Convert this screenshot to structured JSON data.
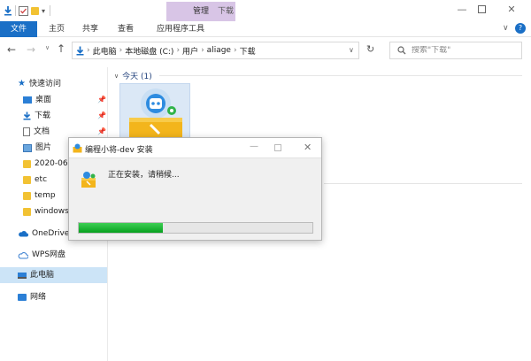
{
  "explorer": {
    "ribbon_tabs": [
      {
        "label": "文件"
      },
      {
        "label": "主页"
      },
      {
        "label": "共享"
      },
      {
        "label": "查看"
      },
      {
        "label": "应用程序工具"
      }
    ],
    "contextual_tab": "管理",
    "window_title": "下载",
    "address_path": [
      "此电脑",
      "本地磁盘 (C:)",
      "用户",
      "aliage",
      "下载"
    ],
    "search_placeholder": "搜索\"下载\"",
    "nav": {
      "quick_access": "快速访问",
      "quick_items": [
        {
          "label": "桌面",
          "pinned": true
        },
        {
          "label": "下载",
          "pinned": true
        },
        {
          "label": "文档",
          "pinned": true
        },
        {
          "label": "图片",
          "pinned": true
        },
        {
          "label": "2020-06",
          "pinned": false
        },
        {
          "label": "etc",
          "pinned": false
        },
        {
          "label": "temp",
          "pinned": false
        },
        {
          "label": "windows",
          "pinned": false
        }
      ],
      "onedrive": "OneDrive",
      "wps": "WPS网盘",
      "this_pc": "此电脑",
      "network": "网络"
    },
    "group_header": "今天 (1)"
  },
  "installer": {
    "title": "编程小将-dev 安装",
    "message": "正在安装，请稍候...",
    "progress_percent": 36
  },
  "colors": {
    "accent": "#1a6fc6",
    "manage_tab": "#d8c5e6",
    "progress": "#16b02e",
    "folder": "#f2c233"
  }
}
